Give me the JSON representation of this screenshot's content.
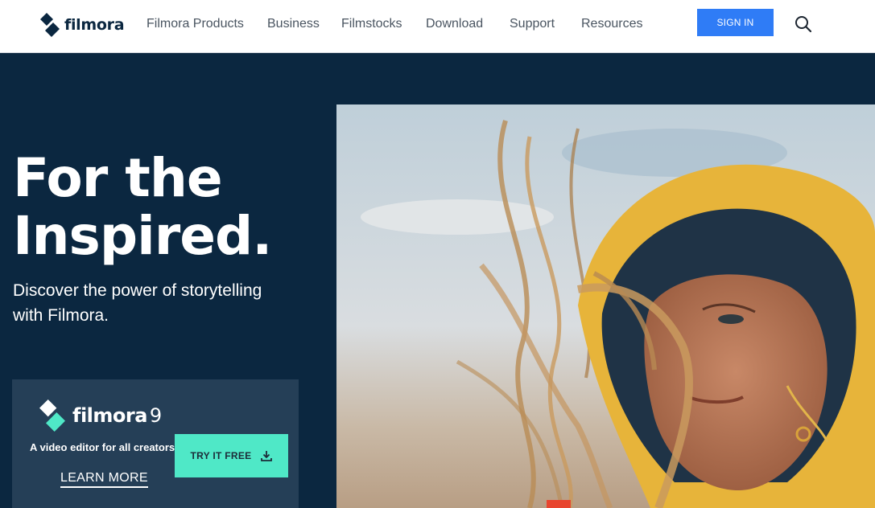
{
  "header": {
    "logo_text": "filmora",
    "nav": [
      "Filmora Products",
      "Business",
      "Filmstocks",
      "Download",
      "Support",
      "Resources"
    ],
    "signin_label": "SIGN IN"
  },
  "hero": {
    "title_line1": "For the",
    "title_line2": "Inspired.",
    "subtitle_line1": "Discover the power of storytelling",
    "subtitle_line2": "with Filmora."
  },
  "card": {
    "product_name": "filmora",
    "product_version": "9",
    "tagline": "A video editor for all creators.",
    "try_label": "TRY IT FREE",
    "learn_label": "LEARN MORE"
  },
  "icons": {
    "logo": "filmora-diamond-logo-icon",
    "search": "search-icon",
    "download": "download-icon"
  },
  "colors": {
    "hero_bg": "#0b2740",
    "card_bg": "#253f57",
    "signin_bg": "#2f7cf6",
    "try_bg": "#4fe8c7",
    "logo_accent": "#4fe8c7"
  }
}
